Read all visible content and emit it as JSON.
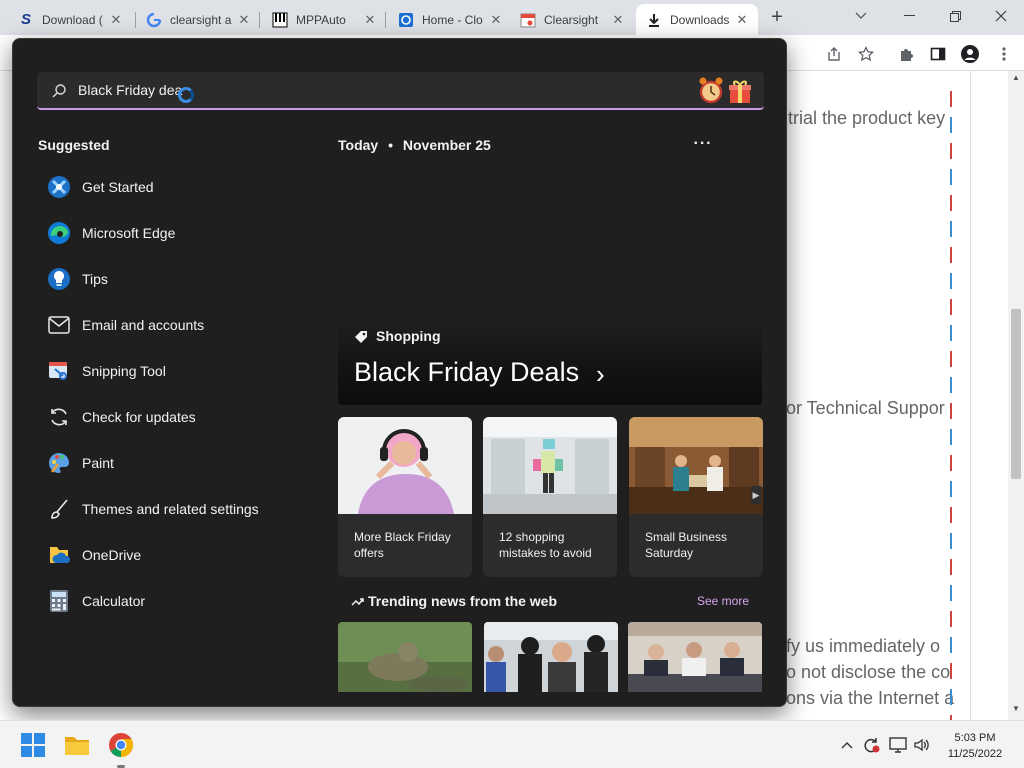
{
  "browser": {
    "tabs": [
      {
        "title": "Download (",
        "favicon": "skype-s-icon",
        "color": "#1a3c8f"
      },
      {
        "title": "clearsight a",
        "favicon": "google-g-icon",
        "color": "#4285f4"
      },
      {
        "title": "MPPAuto",
        "favicon": "piano-icon",
        "color": "#000000"
      },
      {
        "title": "Home - Clo",
        "favicon": "blue-globe-icon",
        "color": "#1c6fd1"
      },
      {
        "title": "Clearsight",
        "favicon": "calendar-icon",
        "color": "#e64a3c"
      },
      {
        "title": "Downloads",
        "favicon": "download-icon",
        "color": "#202124"
      }
    ],
    "close_glyph": "✕",
    "new_tab_glyph": "+"
  },
  "page_behind": {
    "line1": "trial the product key",
    "line2": "or Technical Suppor",
    "line3": "fy us immediately o",
    "line4": "o not disclose the co",
    "line5": "ons via the Internet a"
  },
  "start_menu": {
    "search": {
      "value": "Black Friday dea"
    },
    "suggested_heading": "Suggested",
    "suggested": [
      {
        "label": "Get Started",
        "icon": "get-started-icon"
      },
      {
        "label": "Microsoft Edge",
        "icon": "edge-icon"
      },
      {
        "label": "Tips",
        "icon": "tips-bulb-icon"
      },
      {
        "label": "Email and accounts",
        "icon": "mail-icon"
      },
      {
        "label": "Snipping Tool",
        "icon": "snipping-tool-icon"
      },
      {
        "label": "Check for updates",
        "icon": "refresh-icon"
      },
      {
        "label": "Paint",
        "icon": "paint-palette-icon"
      },
      {
        "label": "Themes and related settings",
        "icon": "brush-icon"
      },
      {
        "label": "OneDrive",
        "icon": "onedrive-icon"
      },
      {
        "label": "Calculator",
        "icon": "calculator-icon"
      }
    ],
    "today_label": "Today",
    "bullet": "•",
    "date": "November 25",
    "more_glyph": "···",
    "hero": {
      "tag": "Shopping",
      "title": "Black Friday Deals",
      "chevron": "›"
    },
    "cards": [
      {
        "text": "More Black Friday offers"
      },
      {
        "text": "12 shopping mistakes to avoid"
      },
      {
        "text": "Small Business Saturday"
      }
    ],
    "trending": {
      "heading": "Trending news from the web",
      "see_more": "See more"
    }
  },
  "taskbar": {
    "time": "5:03 PM",
    "date": "11/25/2022"
  },
  "colors": {
    "accent_underline": "#c79ce6",
    "see_more": "#d6a6f0"
  }
}
